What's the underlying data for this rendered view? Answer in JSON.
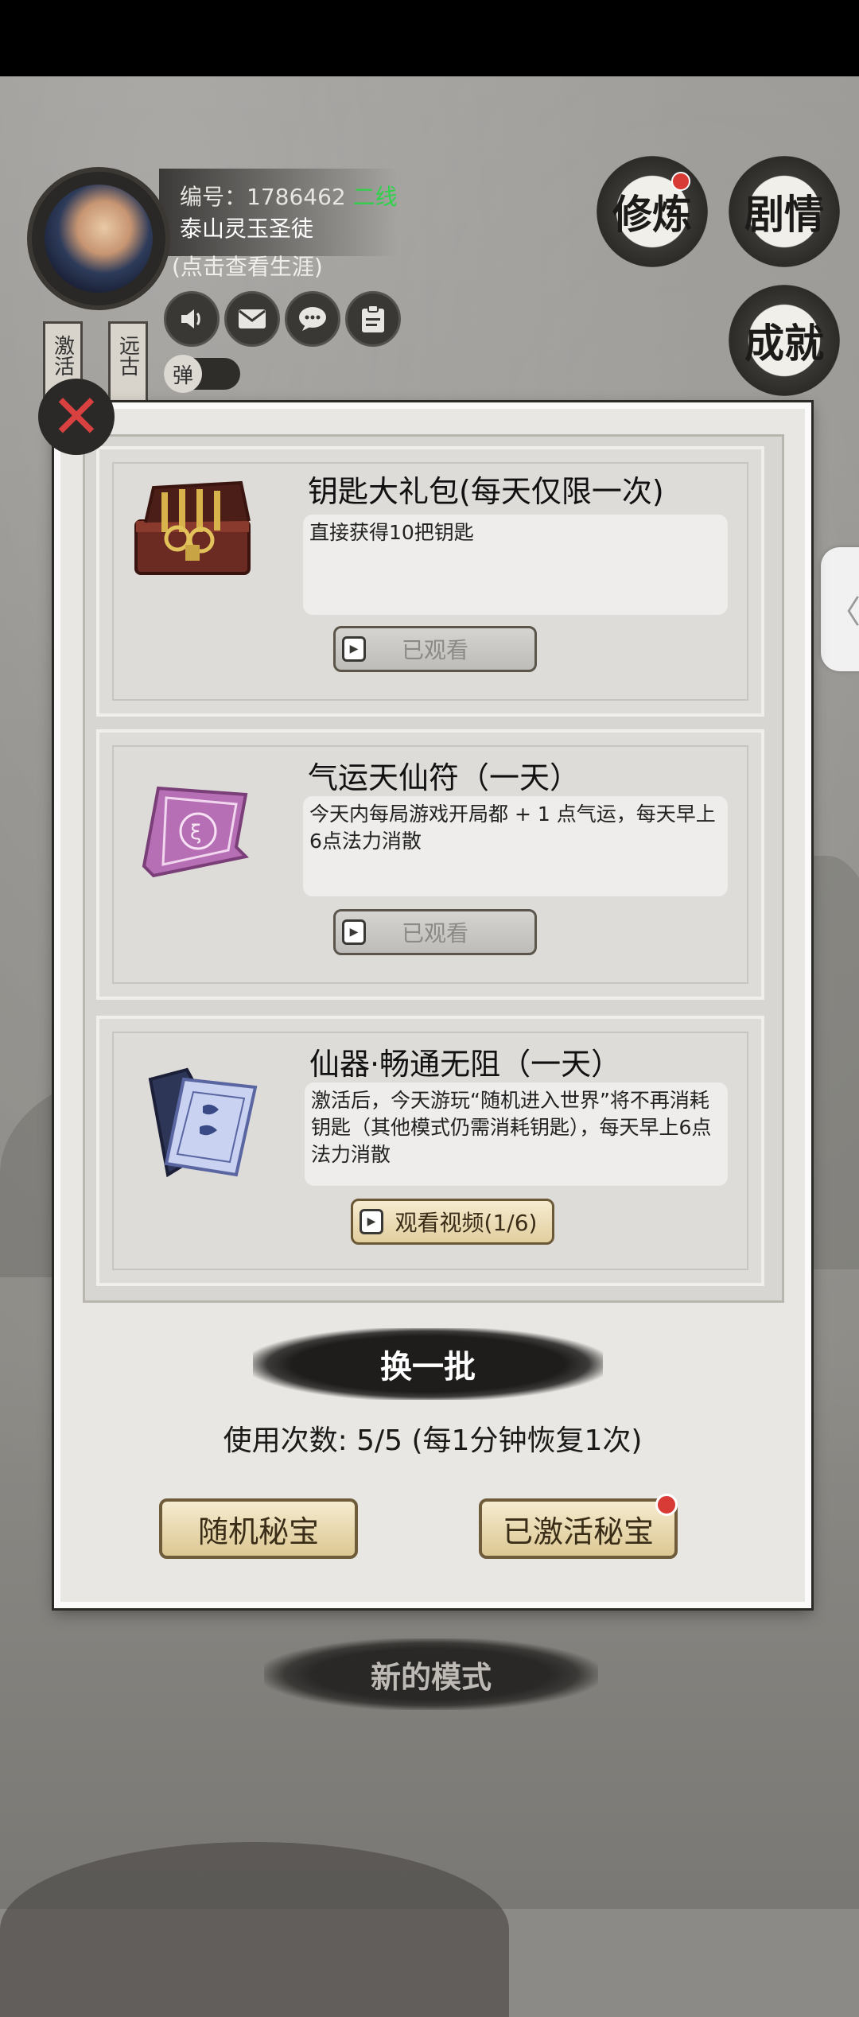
{
  "header": {
    "player_id": "编号：1786462",
    "player_line": "二线",
    "player_title": "泰山灵玉圣徒",
    "career_link": "(点击查看生涯)",
    "toggle_label": "弹",
    "side_tabs": [
      "激活",
      "远古"
    ],
    "ink_buttons": [
      "修炼",
      "剧情",
      "成就"
    ]
  },
  "modal": {
    "close_icon": "✕",
    "items": [
      {
        "title": "钥匙大礼包(每天仅限一次)",
        "desc": "直接获得10把钥匙",
        "button": "已观看",
        "state": "done"
      },
      {
        "title": "气运天仙符（一天）",
        "desc": "今天内每局游戏开局都 + 1 点气运，每天早上6点法力消散",
        "button": "已观看",
        "state": "done"
      },
      {
        "title": "仙器·畅通无阻（一天）",
        "desc": "激活后，今天游玩“随机进入世界”将不再消耗钥匙（其他模式仍需消耗钥匙），每天早上6点法力消散",
        "button": "观看视频(1/6)",
        "state": "active"
      }
    ],
    "refresh_label": "换一批",
    "usage_text": "使用次数: 5/5 (每1分钟恢复1次)",
    "btn_random": "随机秘宝",
    "btn_activated": "已激活秘宝"
  },
  "new_mode_label": "新的模式",
  "side_handle_icon": "〈"
}
